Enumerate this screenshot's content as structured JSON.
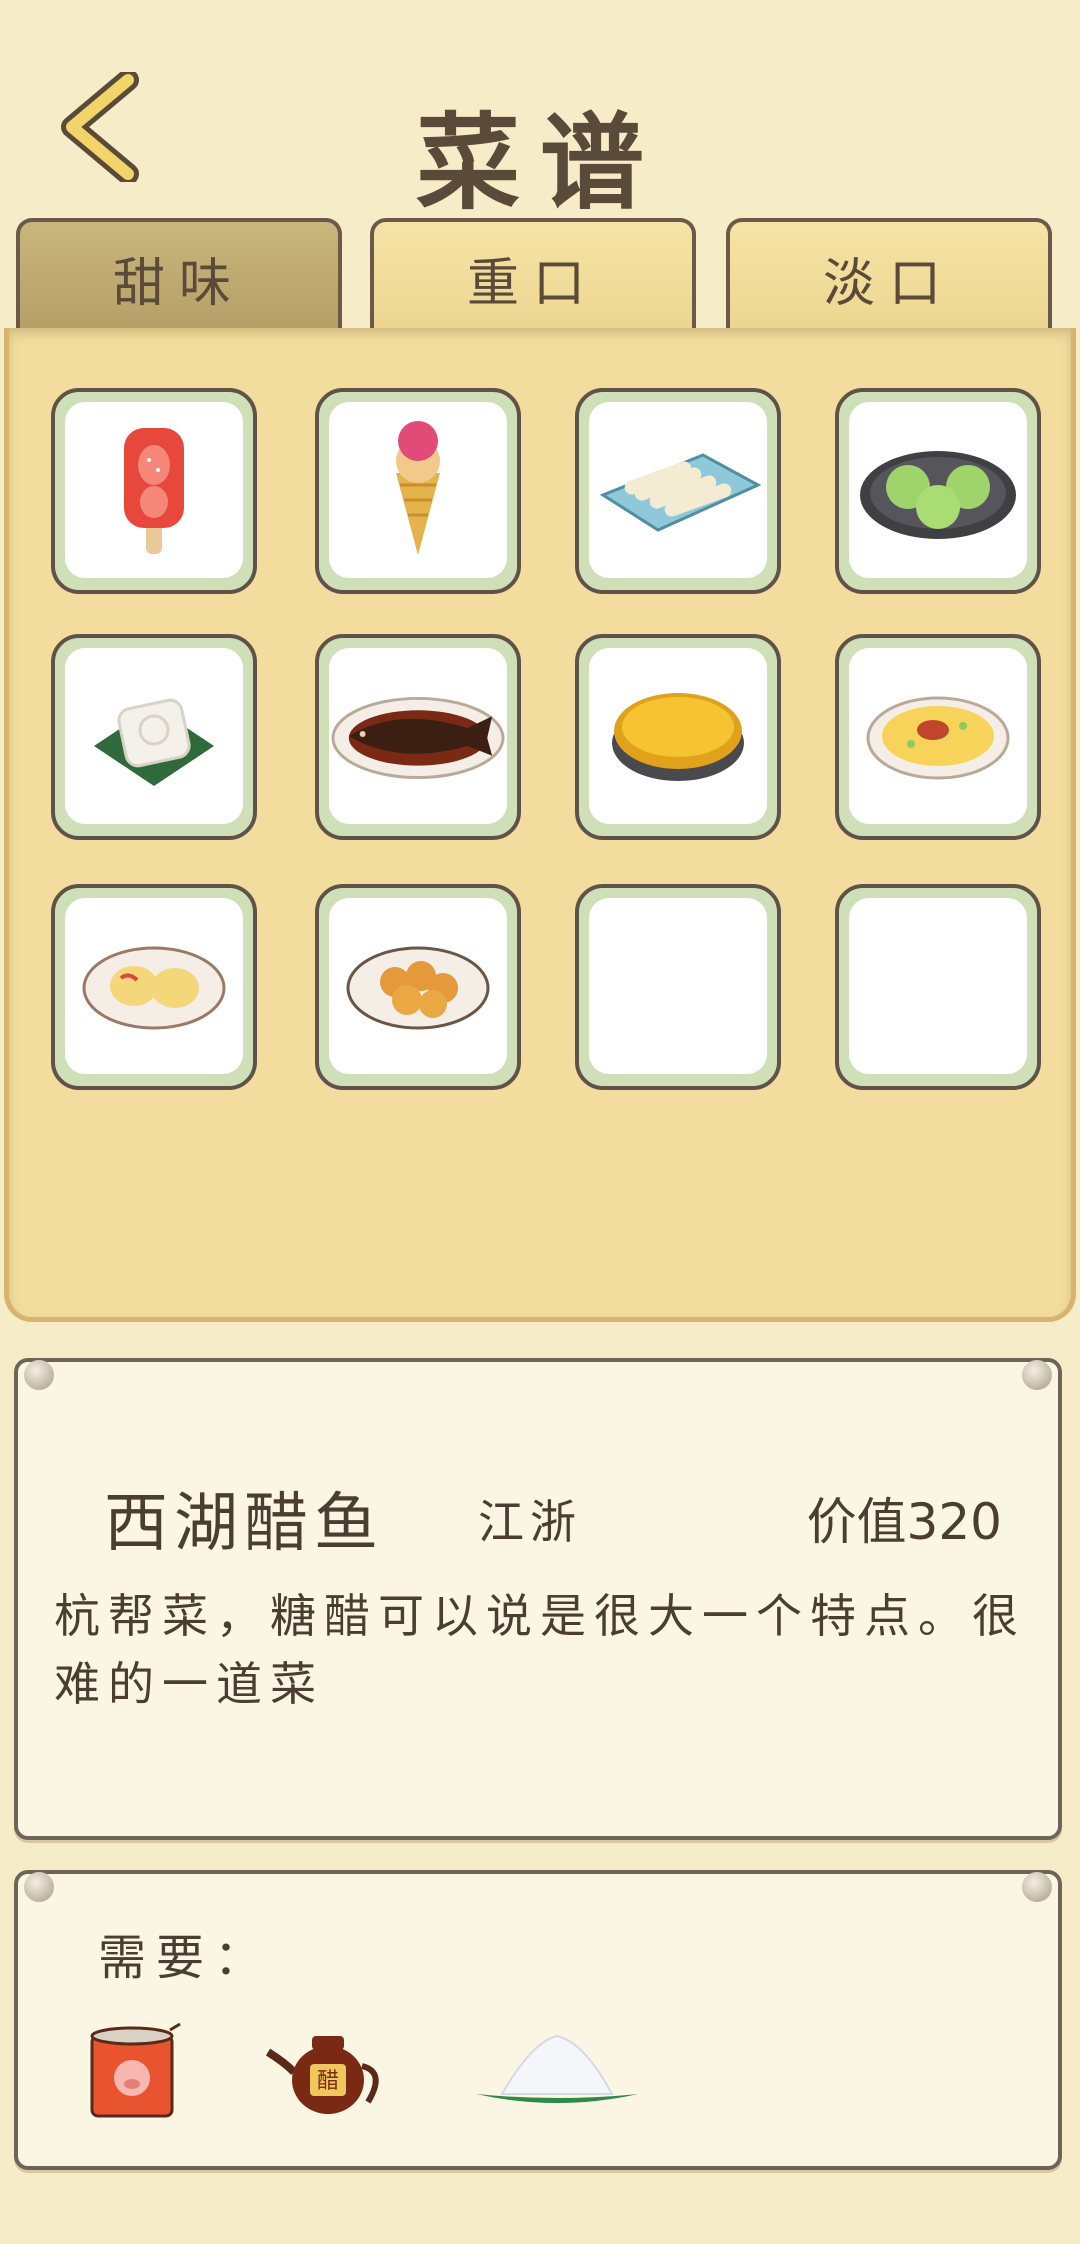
{
  "header": {
    "title": "菜谱",
    "back_icon": "chevron-left-icon"
  },
  "tabs": [
    {
      "label": "甜味",
      "active": true
    },
    {
      "label": "重口",
      "active": false
    },
    {
      "label": "淡口",
      "active": false
    }
  ],
  "recipes": [
    {
      "icon": "strawberry-popsicle-icon"
    },
    {
      "icon": "ice-cream-cone-icon"
    },
    {
      "icon": "rice-rolls-platter-icon"
    },
    {
      "icon": "green-rice-balls-icon"
    },
    {
      "icon": "osmanthus-cake-icon"
    },
    {
      "icon": "west-lake-fish-icon"
    },
    {
      "icon": "egg-tart-icon"
    },
    {
      "icon": "fried-egg-dish-icon"
    },
    {
      "icon": "pastry-plate-icon"
    },
    {
      "icon": "sweet-buns-plate-icon"
    },
    {
      "icon": "empty-slot"
    },
    {
      "icon": "empty-slot"
    }
  ],
  "detail": {
    "name": "西湖醋鱼",
    "region": "江浙",
    "value": "价值320",
    "description": "杭帮菜，糖醋可以说是很大一个特点。很难的一道菜"
  },
  "requirements": {
    "label": "需要：",
    "ingredients": [
      {
        "icon": "canned-pork-icon",
        "text": ""
      },
      {
        "icon": "vinegar-teapot-icon",
        "text": "醋"
      },
      {
        "icon": "sugar-pile-icon",
        "text": ""
      }
    ]
  },
  "colors": {
    "background": "#f7ecc8",
    "panel": "#f2dd9f",
    "tab_active": "#b5a068",
    "cell_border": "#5f5248",
    "cell_mat": "#cfe0b9"
  }
}
